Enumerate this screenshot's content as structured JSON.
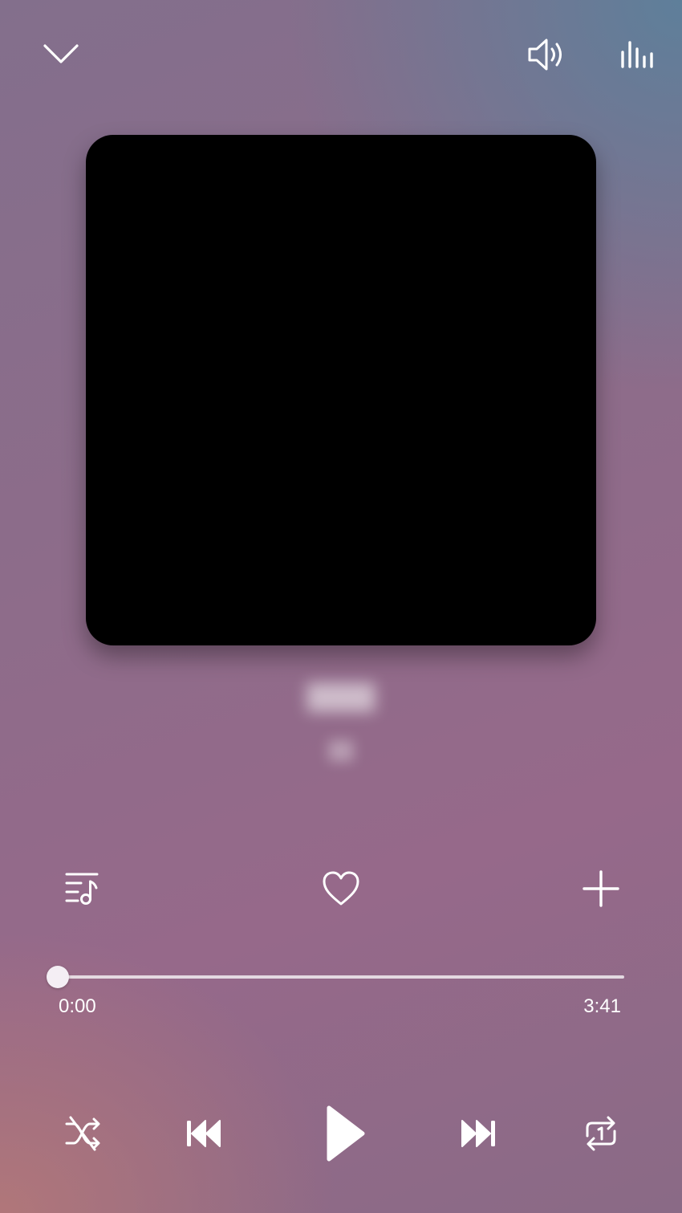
{
  "header": {
    "collapse_icon": "chevron-down-icon",
    "volume_icon": "speaker-icon",
    "equalizer_icon": "equalizer-icon"
  },
  "track": {
    "title": "████",
    "artist": "██"
  },
  "actions": {
    "queue_icon": "playlist-music-icon",
    "favorite_icon": "heart-icon",
    "add_icon": "plus-icon"
  },
  "progress": {
    "elapsed": "0:00",
    "total": "3:41",
    "fraction": 0.0
  },
  "controls": {
    "shuffle_icon": "shuffle-off-icon",
    "previous_icon": "previous-icon",
    "play_icon": "play-icon",
    "next_icon": "next-icon",
    "repeat_icon": "repeat-one-icon"
  },
  "colors": {
    "accent": "#ffffff",
    "background_top_right": "#5c809b",
    "background_bottom_left": "#b47878"
  }
}
